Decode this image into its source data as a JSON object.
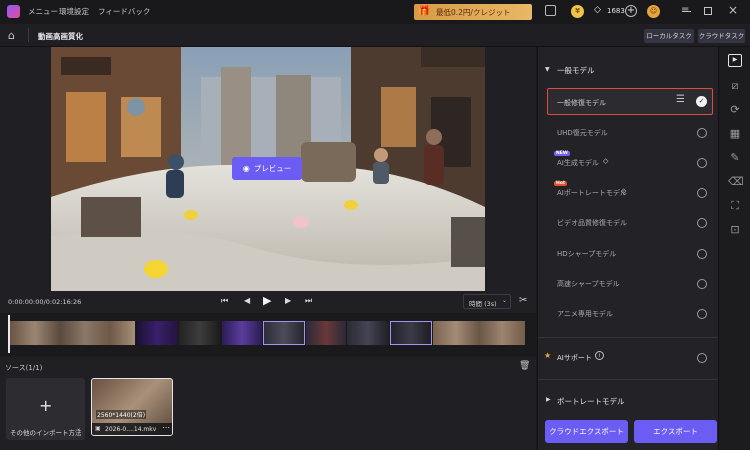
{
  "titlebar": {
    "menu": [
      "メニュー",
      "環境設定",
      "フィードバック"
    ],
    "promo": "最低0.2円/クレジット",
    "credits": "1683"
  },
  "subbar": {
    "title": "動画高画質化",
    "tab_local": "ローカルタスク",
    "tab_cloud": "クラウドタスク"
  },
  "preview": {
    "button_label": "プレビュー"
  },
  "controls": {
    "timecode": "0:00:00:00/0:02:16:26",
    "duration": "時間 (3s)"
  },
  "source": {
    "header": "ソース(1/1)",
    "import_label": "その他のインポート方法",
    "clip_resolution": "2560*1440(2倍)",
    "clip_name": "2026-0....14.mkv"
  },
  "panel": {
    "section_general": "一般モデル",
    "models": [
      {
        "label": "一般修復モデル",
        "selected": true,
        "badge": ""
      },
      {
        "label": "UHD復元モデル",
        "selected": false,
        "badge": ""
      },
      {
        "label": "AI生成モデル",
        "selected": false,
        "badge": "NEW"
      },
      {
        "label": "AIポートレートモデル",
        "selected": false,
        "badge": "Hot"
      },
      {
        "label": "ビデオ品質修復モデル",
        "selected": false,
        "badge": ""
      },
      {
        "label": "HDシャープモデル",
        "selected": false,
        "badge": ""
      },
      {
        "label": "高速シャープモデル",
        "selected": false,
        "badge": ""
      },
      {
        "label": "アニメ専用モデル",
        "selected": false,
        "badge": ""
      }
    ],
    "ai_support": "AIサポート",
    "section_portrait": "ポートレートモデル",
    "cloud_export": "クラウドエクスポート",
    "export": "エクスポート"
  },
  "colors": {
    "accent": "#6b5cf4",
    "selection_border": "#e04a3f",
    "promo_bg": "#e0a94f",
    "background": "#1b1b1e"
  }
}
